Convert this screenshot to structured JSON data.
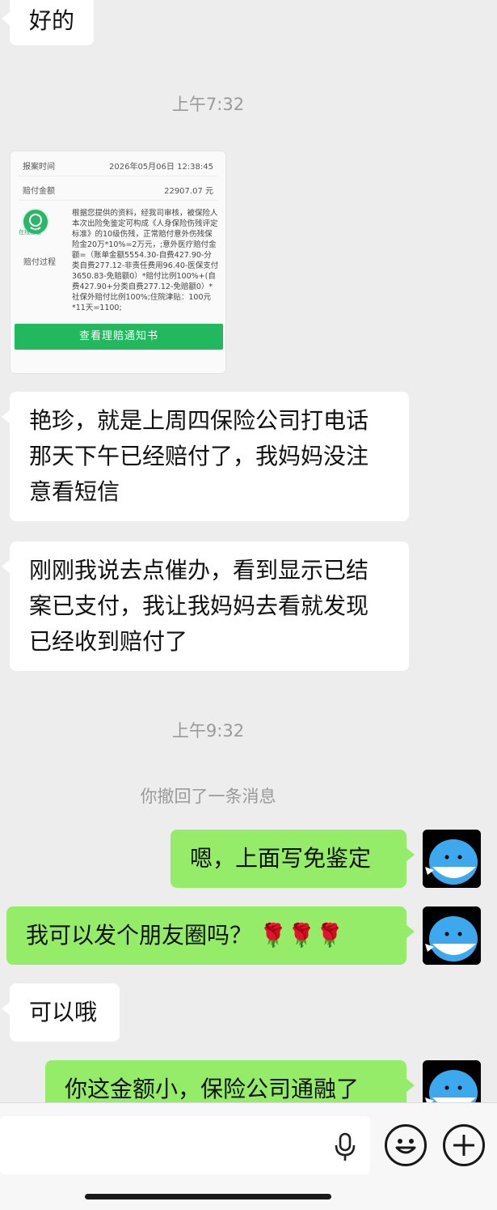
{
  "messages": {
    "m0": "好的",
    "t1": "上午7:32",
    "m2": "艳珍，就是上周四保险公司打电话那天下午已经赔付了，我妈妈没注意看短信",
    "m3": "刚刚我说去点催办，看到显示已结案已支付，我让我妈妈去看就发现已经收到赔付了",
    "t2": "上午9:32",
    "recall": "你撤回了一条消息",
    "m4": "嗯，上面写免鉴定",
    "m5": "我可以发个朋友圈吗？",
    "m5_emoji": "🌹🌹🌹",
    "m6": "可以哦",
    "m7": "你这金额小，保险公司通融了"
  },
  "claim_card": {
    "report_time_label": "报案时间",
    "report_time_value": "2026年05月06日 12:38:45",
    "amount_label": "赔付金额",
    "amount_value": "22907.07 元",
    "badge_label": "在线客服",
    "process_label": "赔付过程",
    "process_text": "根据您提供的资料，经我司审核，被保险人本次出险免鉴定可构成《人身保险伤残评定标准》的10级伤残，正常赔付意外伤残保险金20万*10%=2万元，;意外医疗赔付金额=（账单金额5554.30-自费427.90-分类自费277.12-非责任费用96.40-医保支付3650.83-免赔额0）*赔付比例100%+(自费427.90+分类自费277.12-免赔额0）*社保外赔付比例100%;住院津贴：100元*11天=1100;",
    "button_label": "查看理赔通知书"
  },
  "input_bar": {
    "mic_icon": "microphone-icon",
    "emoji_icon": "smiley-icon",
    "plus_icon": "plus-icon"
  },
  "colors": {
    "background": "#ededed",
    "incoming_bubble": "#ffffff",
    "outgoing_bubble": "#95ec69",
    "button_green": "#22b85e"
  }
}
